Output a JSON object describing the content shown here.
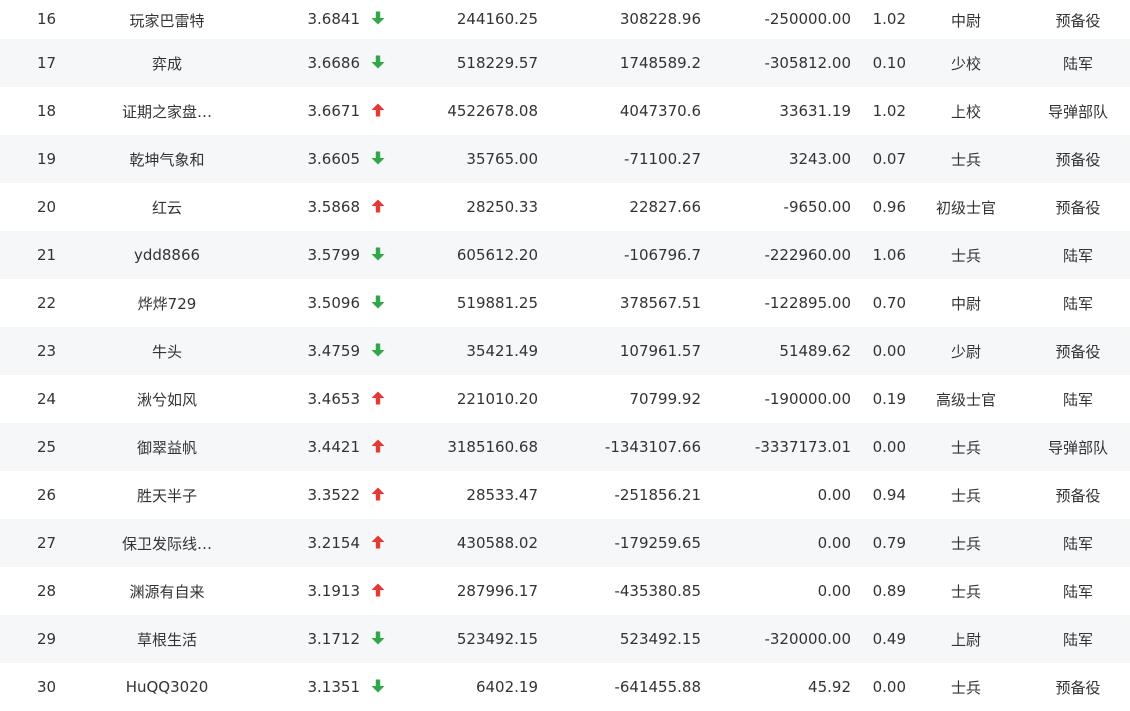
{
  "colors": {
    "up": "#e53935",
    "down": "#2ea84a",
    "row_alt": "#f6f7f8",
    "text": "#333333"
  },
  "rows": [
    {
      "rank": "16",
      "name": "玩家巴雷特",
      "index": "3.6841",
      "trend": "down",
      "trend_icon": "arrow-down-icon",
      "v1": "244160.25",
      "v2": "308228.96",
      "v3": "-250000.00",
      "ratio": "1.02",
      "level": "中尉",
      "branch": "预备役"
    },
    {
      "rank": "17",
      "name": "弈成",
      "index": "3.6686",
      "trend": "down",
      "trend_icon": "arrow-down-icon",
      "v1": "518229.57",
      "v2": "1748589.2",
      "v3": "-305812.00",
      "ratio": "0.10",
      "level": "少校",
      "branch": "陆军"
    },
    {
      "rank": "18",
      "name": "证期之家盘…",
      "index": "3.6671",
      "trend": "up",
      "trend_icon": "arrow-up-icon",
      "v1": "4522678.08",
      "v2": "4047370.6",
      "v3": "33631.19",
      "ratio": "1.02",
      "level": "上校",
      "branch": "导弹部队"
    },
    {
      "rank": "19",
      "name": "乾坤气象和",
      "index": "3.6605",
      "trend": "down",
      "trend_icon": "arrow-down-icon",
      "v1": "35765.00",
      "v2": "-71100.27",
      "v3": "3243.00",
      "ratio": "0.07",
      "level": "士兵",
      "branch": "预备役"
    },
    {
      "rank": "20",
      "name": "红云",
      "index": "3.5868",
      "trend": "up",
      "trend_icon": "arrow-up-icon",
      "v1": "28250.33",
      "v2": "22827.66",
      "v3": "-9650.00",
      "ratio": "0.96",
      "level": "初级士官",
      "branch": "预备役"
    },
    {
      "rank": "21",
      "name": "ydd8866",
      "index": "3.5799",
      "trend": "down",
      "trend_icon": "arrow-down-icon",
      "v1": "605612.20",
      "v2": "-106796.7",
      "v3": "-222960.00",
      "ratio": "1.06",
      "level": "士兵",
      "branch": "陆军"
    },
    {
      "rank": "22",
      "name": "烨烨729",
      "index": "3.5096",
      "trend": "down",
      "trend_icon": "arrow-down-icon",
      "v1": "519881.25",
      "v2": "378567.51",
      "v3": "-122895.00",
      "ratio": "0.70",
      "level": "中尉",
      "branch": "陆军"
    },
    {
      "rank": "23",
      "name": "牛头",
      "index": "3.4759",
      "trend": "down",
      "trend_icon": "arrow-down-icon",
      "v1": "35421.49",
      "v2": "107961.57",
      "v3": "51489.62",
      "ratio": "0.00",
      "level": "少尉",
      "branch": "预备役"
    },
    {
      "rank": "24",
      "name": "湫兮如风",
      "index": "3.4653",
      "trend": "up",
      "trend_icon": "arrow-up-icon",
      "v1": "221010.20",
      "v2": "70799.92",
      "v3": "-190000.00",
      "ratio": "0.19",
      "level": "高级士官",
      "branch": "陆军"
    },
    {
      "rank": "25",
      "name": "御翠益帆",
      "index": "3.4421",
      "trend": "up",
      "trend_icon": "arrow-up-icon",
      "v1": "3185160.68",
      "v2": "-1343107.66",
      "v3": "-3337173.01",
      "ratio": "0.00",
      "level": "士兵",
      "branch": "导弹部队"
    },
    {
      "rank": "26",
      "name": "胜天半子",
      "index": "3.3522",
      "trend": "up",
      "trend_icon": "arrow-up-icon",
      "v1": "28533.47",
      "v2": "-251856.21",
      "v3": "0.00",
      "ratio": "0.94",
      "level": "士兵",
      "branch": "预备役"
    },
    {
      "rank": "27",
      "name": "保卫发际线…",
      "index": "3.2154",
      "trend": "up",
      "trend_icon": "arrow-up-icon",
      "v1": "430588.02",
      "v2": "-179259.65",
      "v3": "0.00",
      "ratio": "0.79",
      "level": "士兵",
      "branch": "陆军"
    },
    {
      "rank": "28",
      "name": "渊源有自来",
      "index": "3.1913",
      "trend": "up",
      "trend_icon": "arrow-up-icon",
      "v1": "287996.17",
      "v2": "-435380.85",
      "v3": "0.00",
      "ratio": "0.89",
      "level": "士兵",
      "branch": "陆军"
    },
    {
      "rank": "29",
      "name": "草根生活",
      "index": "3.1712",
      "trend": "down",
      "trend_icon": "arrow-down-icon",
      "v1": "523492.15",
      "v2": "523492.15",
      "v3": "-320000.00",
      "ratio": "0.49",
      "level": "上尉",
      "branch": "陆军"
    },
    {
      "rank": "30",
      "name": "HuQQ3020",
      "index": "3.1351",
      "trend": "down",
      "trend_icon": "arrow-down-icon",
      "v1": "6402.19",
      "v2": "-641455.88",
      "v3": "45.92",
      "ratio": "0.00",
      "level": "士兵",
      "branch": "预备役"
    }
  ]
}
